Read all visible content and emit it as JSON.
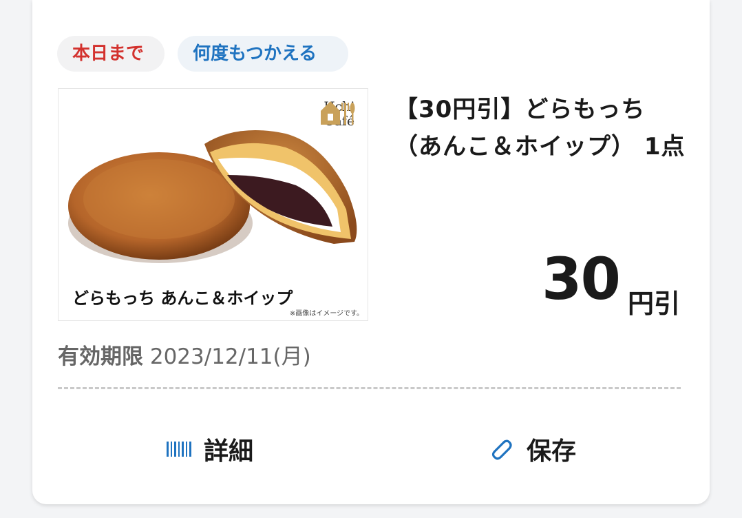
{
  "tags": {
    "deadline": "本日まで",
    "reusable": "何度もつかえる"
  },
  "product": {
    "image_caption": "どらもっち あんこ＆ホイップ",
    "image_note": "※画像はイメージです。",
    "brand_line1": "Uchi",
    "brand_line2": "Café",
    "title": "【30円引】どらもっち（あんこ＆ホイップ） 1点"
  },
  "discount": {
    "amount": "30",
    "unit": "円引"
  },
  "expiry": {
    "label": "有効期限",
    "date": "2023/12/11(月)"
  },
  "actions": {
    "detail": "詳細",
    "save": "保存"
  },
  "colors": {
    "deadline_tag": "#d3322e",
    "reusable_tag": "#1f73c0",
    "icon_blue": "#1f73c0",
    "brand_gold": "#c9a15a"
  },
  "icons": {
    "detail": "barcode-icon",
    "save": "paperclip-icon",
    "brand": "house-cutlery-icon"
  }
}
